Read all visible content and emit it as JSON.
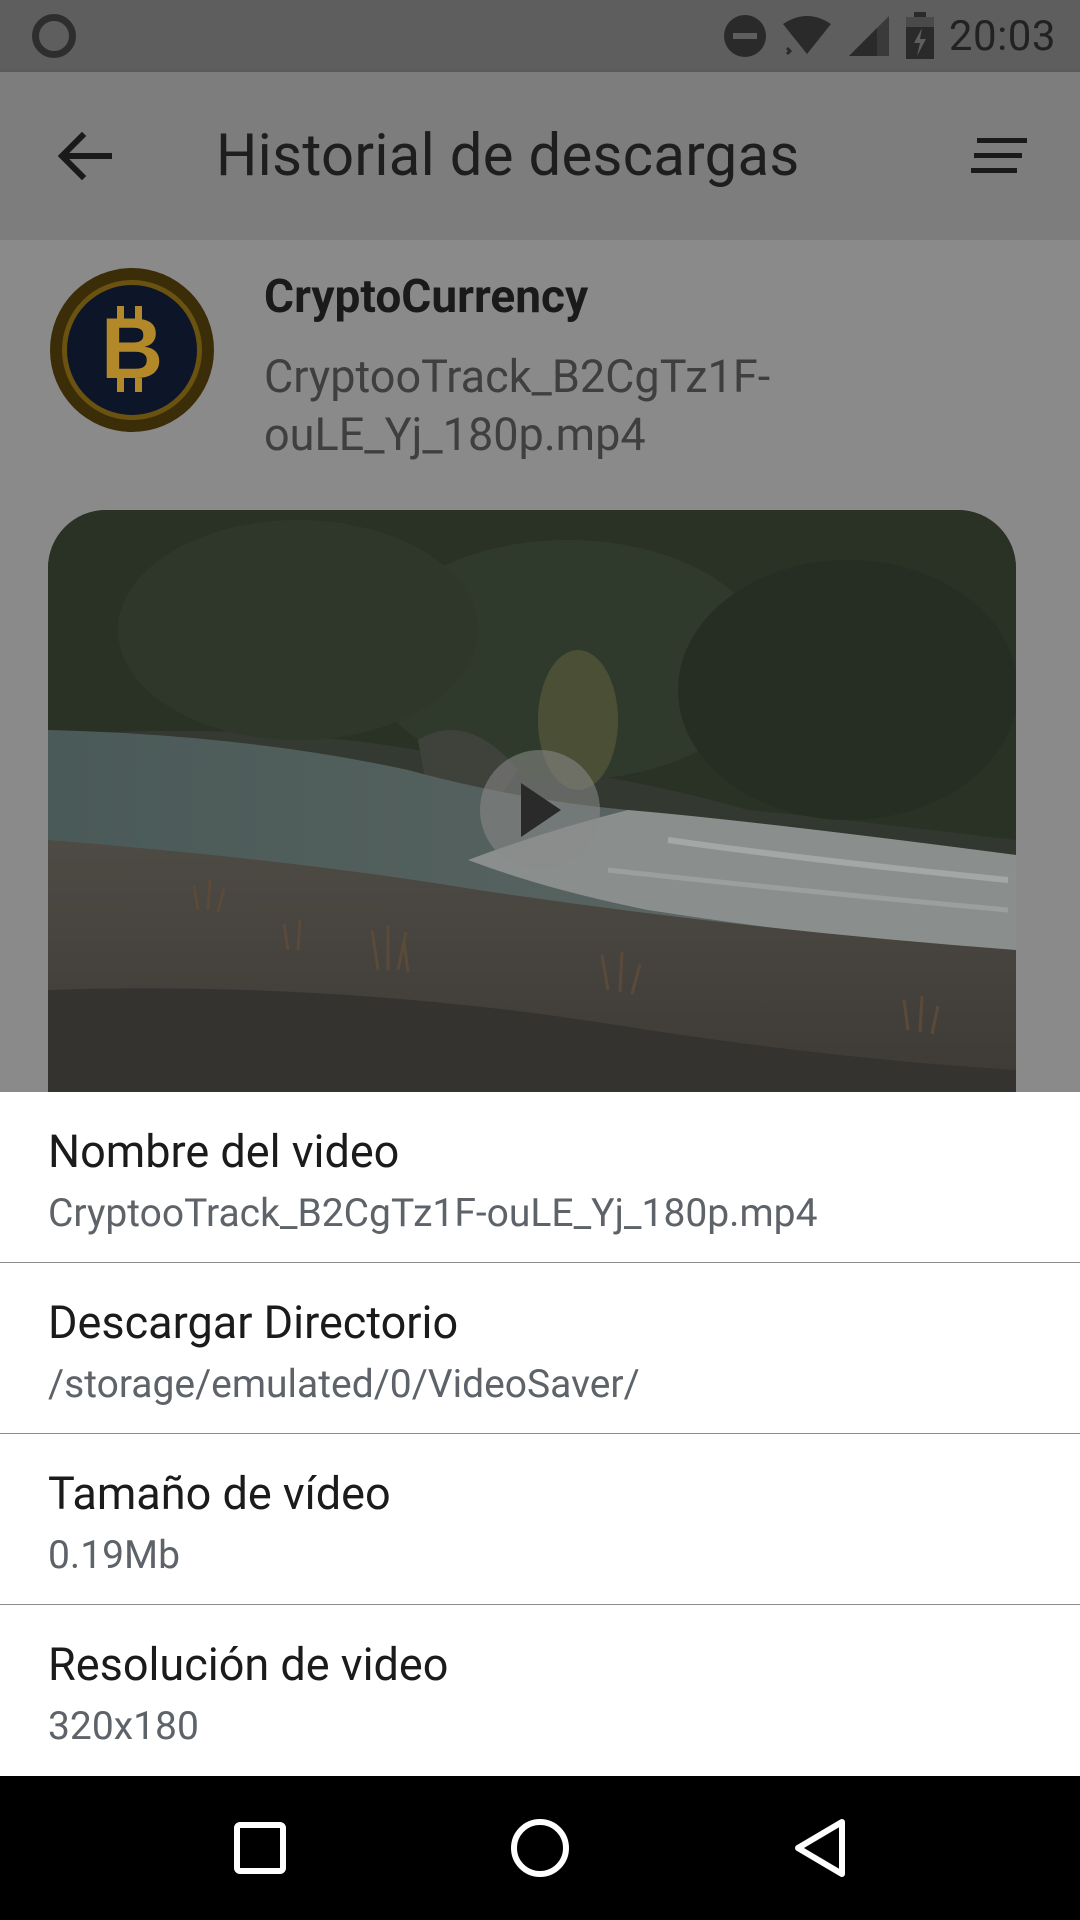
{
  "status_bar": {
    "time": "20:03",
    "icons": [
      "sync-circle-icon",
      "do-not-disturb-icon",
      "wifi-icon",
      "cell-signal-icon",
      "battery-charging-icon"
    ]
  },
  "app_bar": {
    "title": "Historial de descargas",
    "back_icon": "arrow-back-icon",
    "sort_icon": "sort-icon"
  },
  "download_item": {
    "channel_name": "CryptoCurrency",
    "file_name": "CryptooTrack_B2CgTz1F-ouLE_Yj_180p.mp4",
    "avatar_icon": "bitcoin-logo-icon",
    "play_icon": "play-icon"
  },
  "details_sheet": {
    "rows": [
      {
        "label": "Nombre del video",
        "value": "CryptooTrack_B2CgTz1F-ouLE_Yj_180p.mp4"
      },
      {
        "label": "Descargar Directorio",
        "value": "/storage/emulated/0/VideoSaver/"
      },
      {
        "label": "Tamaño de vídeo",
        "value": "0.19Mb"
      },
      {
        "label": "Resolución de video",
        "value": "320x180"
      }
    ]
  },
  "nav_bar": {
    "icons": [
      "recents-square-icon",
      "home-circle-icon",
      "back-triangle-icon"
    ]
  },
  "colors": {
    "scrim": "#8a8a8a",
    "sheet_background": "#ffffff",
    "avatar_gold": "#c79a2a",
    "avatar_navy": "#0c1628"
  }
}
